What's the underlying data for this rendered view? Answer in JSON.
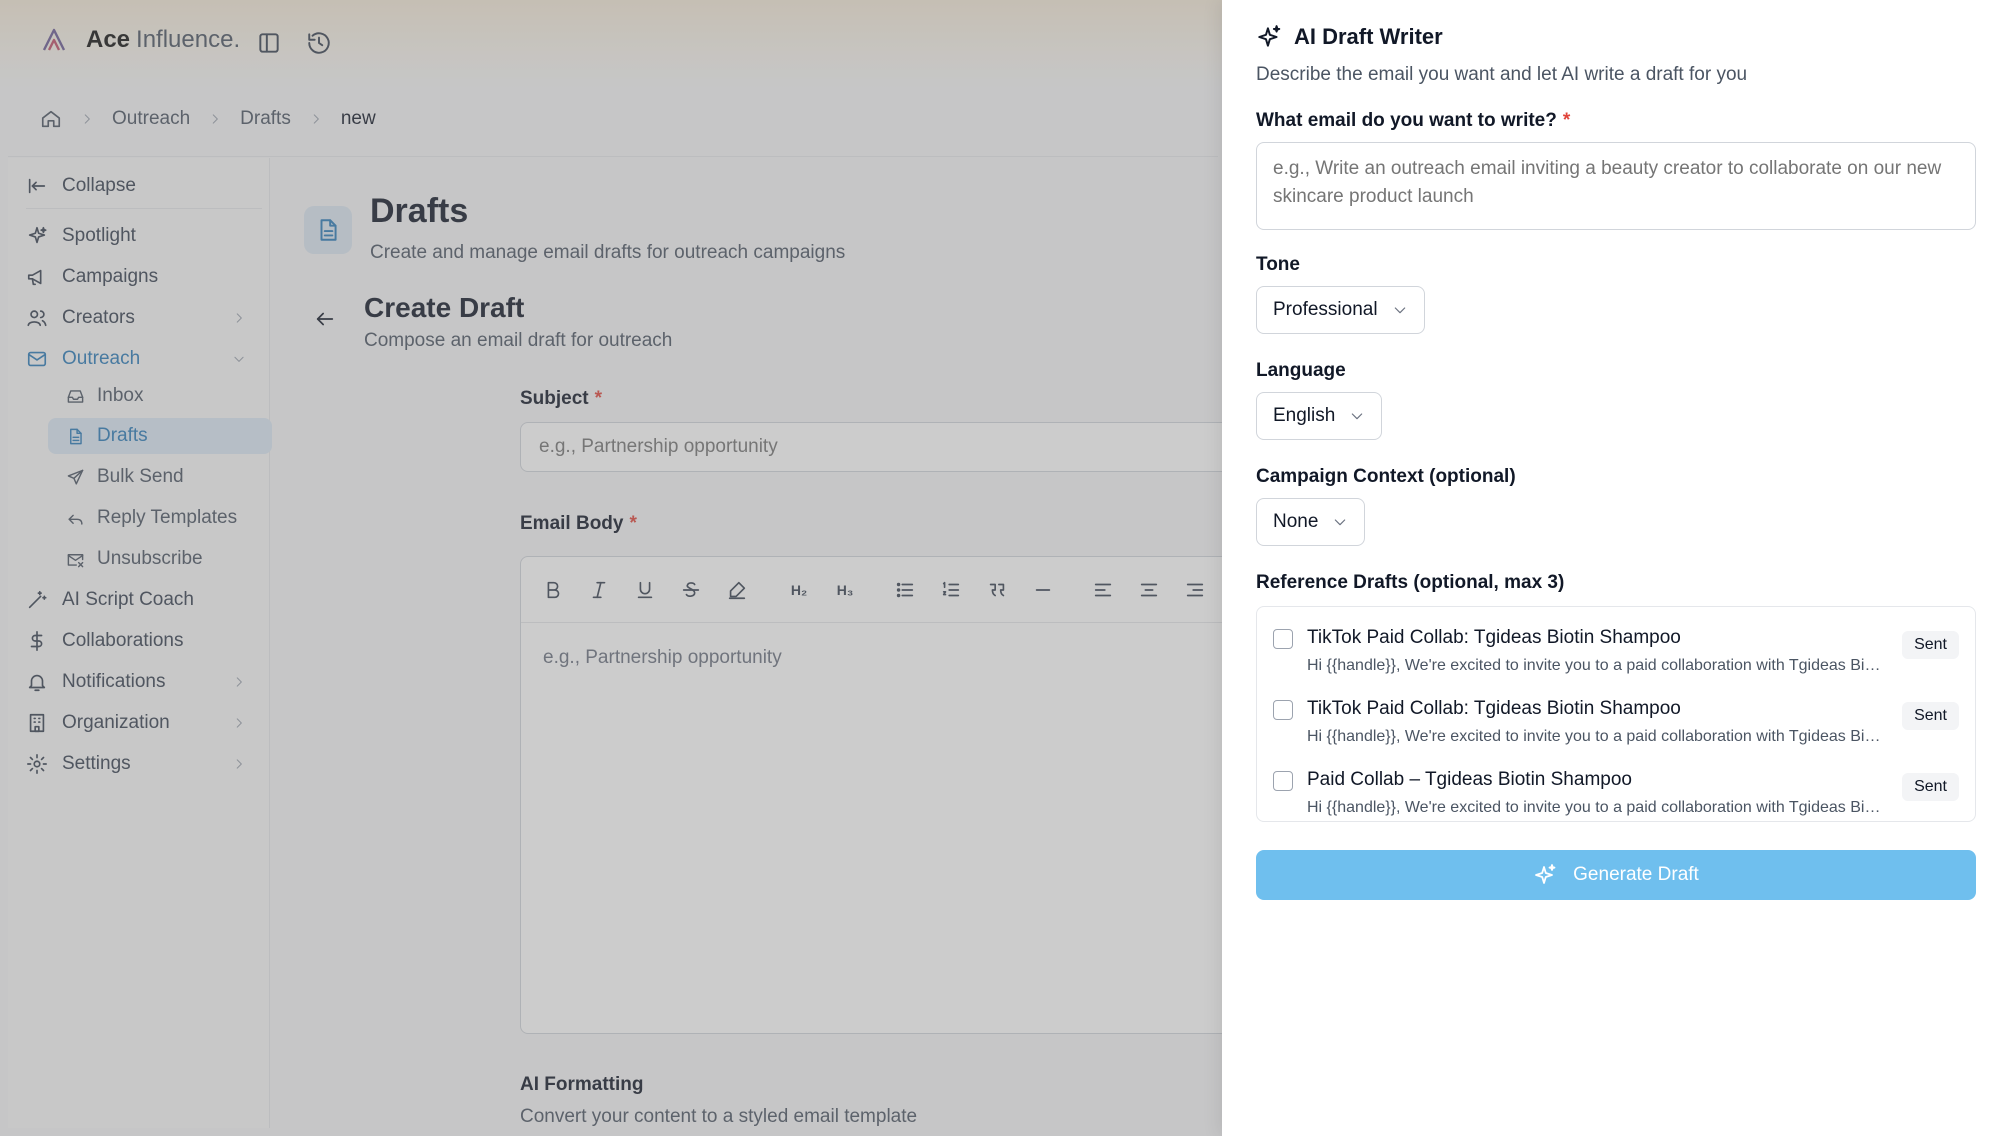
{
  "brand": {
    "name_bold": "Ace",
    "name_light": "Influence."
  },
  "breadcrumb": {
    "items": [
      "Outreach",
      "Drafts"
    ],
    "current": "new"
  },
  "sidebar": {
    "collapse": "Collapse",
    "items": [
      "Spotlight",
      "Campaigns",
      "Creators",
      "Outreach",
      "AI Script Coach",
      "Collaborations",
      "Notifications",
      "Organization",
      "Settings"
    ],
    "outreach_sub": [
      "Inbox",
      "Drafts",
      "Bulk Send",
      "Reply Templates",
      "Unsubscribe"
    ]
  },
  "page": {
    "title": "Drafts",
    "subtitle": "Create and manage email drafts for outreach campaigns"
  },
  "section": {
    "title": "Create Draft",
    "subtitle": "Compose an email draft for outreach"
  },
  "form": {
    "subject_label": "Subject",
    "subject_placeholder": "e.g., Partnership opportunity",
    "body_label": "Email Body",
    "body_placeholder": "e.g., Partnership opportunity",
    "required_mark": "*",
    "toolbar": {
      "h2": "H₂",
      "h3": "H₃"
    },
    "ai_formatting_title": "AI Formatting",
    "ai_formatting_sub": "Convert your content to a styled email template"
  },
  "drawer": {
    "title": "AI Draft Writer",
    "subtitle": "Describe the email you want and let AI write a draft for you",
    "prompt_label": "What email do you want to write?",
    "prompt_placeholder": "e.g., Write an outreach email inviting a beauty creator to collaborate on our new skincare product launch",
    "tone_label": "Tone",
    "tone_value": "Professional",
    "language_label": "Language",
    "language_value": "English",
    "campaign_label": "Campaign Context (optional)",
    "campaign_value": "None",
    "refs_label": "Reference Drafts (optional, max 3)",
    "refs": [
      {
        "title": "TikTok Paid Collab: Tgideas Biotin Shampoo",
        "preview": "Hi {{handle}}, We're excited to invite you to a paid collaboration with Tgideas Biotin Shampoo",
        "status": "Sent"
      },
      {
        "title": "TikTok Paid Collab: Tgideas Biotin Shampoo",
        "preview": "Hi {{handle}}, We're excited to invite you to a paid collaboration with Tgideas Biotin Shampoo",
        "status": "Sent"
      },
      {
        "title": "Paid Collab – Tgideas Biotin Shampoo",
        "preview": "Hi {{handle}}, We're excited to invite you to a paid collaboration with Tgideas Biotin Shampoo",
        "status": "Sent"
      }
    ],
    "generate_label": "Generate Draft"
  },
  "colors": {
    "accent": "#2b7bb9",
    "active_bg": "#dce9f5",
    "generate_button": "#6fbfee",
    "required": "#e0443a"
  }
}
